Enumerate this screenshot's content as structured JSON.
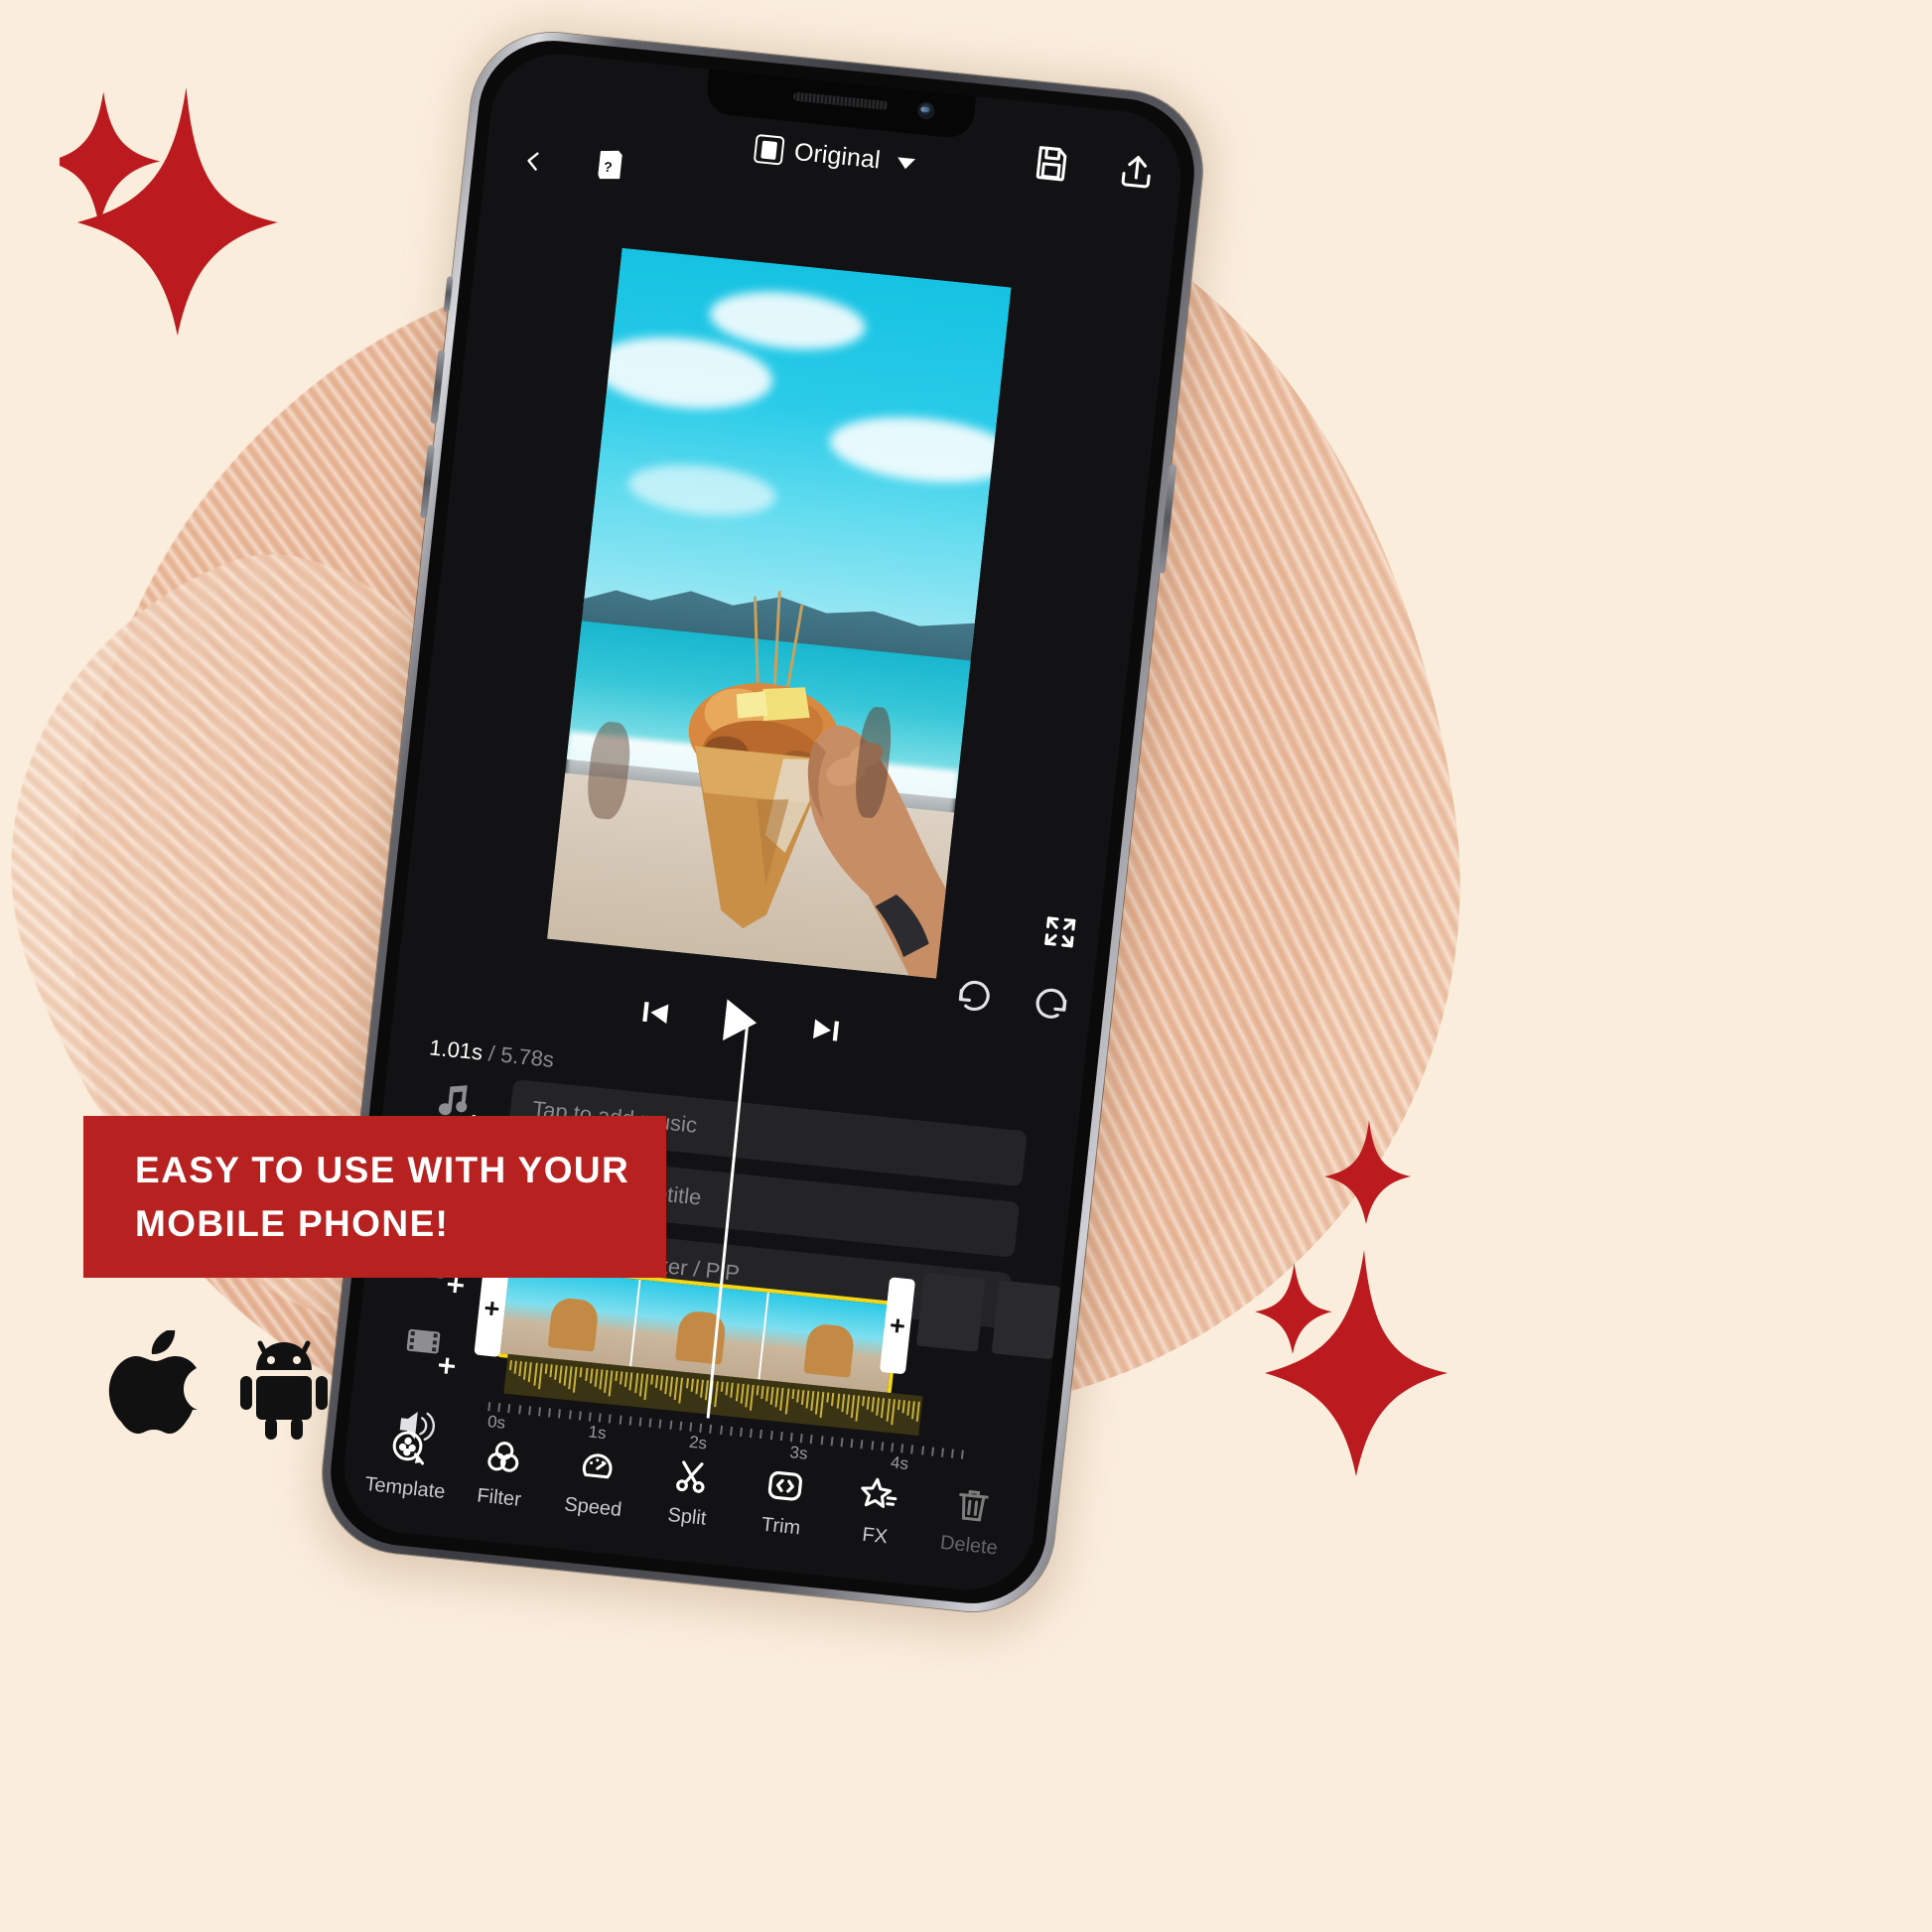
{
  "page": {
    "background_color": "#fbeddc",
    "accent_red": "#b7211f",
    "accent_yellow": "#f5d716"
  },
  "banner": {
    "line1": "EASY TO USE WITH YOUR",
    "line2": "MOBILE PHONE!",
    "bg_color": "#b7211f",
    "text_color": "#ffffff"
  },
  "stores": {
    "apple_icon": "apple-logo-icon",
    "android_icon": "android-robot-icon"
  },
  "decorations": {
    "sparkle_icon": "four-point-star-sparkle-icon",
    "sparkle_color": "#bb1a1f",
    "brush_stroke": "paint-brush-stroke-texture"
  },
  "phone": {
    "device": "smartphone-mockup",
    "notch": {
      "speaker_icon": "earpiece-speaker-icon",
      "camera_icon": "front-camera-icon"
    }
  },
  "app": {
    "topbar": {
      "back_icon": "chevron-left-icon",
      "help_icon": "help-guide-book-icon",
      "ratio_icon": "aspect-ratio-icon",
      "ratio_label": "Original",
      "ratio_caret_icon": "caret-down-icon",
      "save_icon": "save-floppy-disk-icon",
      "export_icon": "export-upload-icon"
    },
    "preview": {
      "expand_icon": "expand-fullscreen-icon",
      "content_description": "beach-video-frame"
    },
    "history": {
      "undo_icon": "undo-arrow-icon",
      "redo_icon": "redo-arrow-icon"
    },
    "transport": {
      "prev_icon": "skip-to-start-icon",
      "play_icon": "play-triangle-icon",
      "next_icon": "skip-to-end-icon"
    },
    "timecode": {
      "current": "1.01s",
      "separator": "/",
      "total": "5.78s"
    },
    "tracks": [
      {
        "icon": "add-music-note-icon",
        "placeholder": "Tap to add music"
      },
      {
        "icon": "add-text-icon",
        "placeholder": "Tap to add subtitle"
      },
      {
        "icon": "add-sticker-pip-icon",
        "placeholder": "Tap to add sticker / PiP"
      },
      {
        "icon": "add-video-clip-icon",
        "placeholder": ""
      },
      {
        "icon": "volume-speaker-icon",
        "placeholder": ""
      }
    ],
    "clip": {
      "handle_left_label": "+",
      "handle_right_label": "+",
      "selected_border_color": "#f5d716"
    },
    "ruler": {
      "labels": [
        "0s",
        "1s",
        "2s",
        "3s",
        "4s"
      ]
    },
    "tools": [
      {
        "icon": "template-film-reel-icon",
        "label": "Template"
      },
      {
        "icon": "filter-circles-icon",
        "label": "Filter"
      },
      {
        "icon": "speed-gauge-icon",
        "label": "Speed"
      },
      {
        "icon": "split-scissors-icon",
        "label": "Split"
      },
      {
        "icon": "trim-brackets-icon",
        "label": "Trim"
      },
      {
        "icon": "fx-star-icon",
        "label": "FX"
      },
      {
        "icon": "delete-trash-icon",
        "label": "Delete"
      }
    ]
  }
}
